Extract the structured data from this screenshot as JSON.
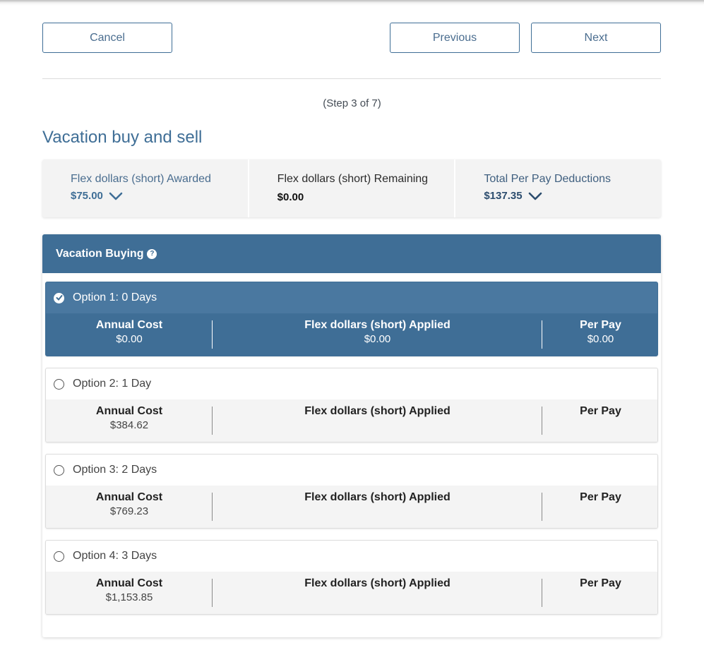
{
  "nav": {
    "cancel_label": "Cancel",
    "previous_label": "Previous",
    "next_label": "Next"
  },
  "step_text": "(Step 3 of 7)",
  "page_title": "Vacation buy and sell",
  "summary": {
    "awarded": {
      "label": "Flex dollars (short) Awarded",
      "value": "$75.00",
      "icon": "chevron-down-icon"
    },
    "remaining": {
      "label": "Flex dollars (short) Remaining",
      "value": "$0.00"
    },
    "deductions": {
      "label": "Total Per Pay Deductions",
      "value": "$137.35",
      "icon": "chevron-down-icon"
    }
  },
  "section": {
    "title": "Vacation Buying",
    "help_icon": "question-circle-icon",
    "columns": {
      "annual_cost": "Annual Cost",
      "flex_applied": "Flex dollars (short) Applied",
      "per_pay": "Per Pay"
    },
    "options": [
      {
        "label": "Option 1: 0 Days",
        "selected": true,
        "annual_cost": "$0.00",
        "flex_applied": "$0.00",
        "per_pay": "$0.00"
      },
      {
        "label": "Option 2: 1 Day",
        "selected": false,
        "annual_cost": "$384.62",
        "flex_applied": "",
        "per_pay": ""
      },
      {
        "label": "Option 3: 2 Days",
        "selected": false,
        "annual_cost": "$769.23",
        "flex_applied": "",
        "per_pay": ""
      },
      {
        "label": "Option 4: 3 Days",
        "selected": false,
        "annual_cost": "$1,153.85",
        "flex_applied": "",
        "per_pay": ""
      }
    ]
  },
  "colors": {
    "primary": "#3f6e96",
    "selected_row": "#4a78a0",
    "summary_bg": "#f3f3f3"
  }
}
